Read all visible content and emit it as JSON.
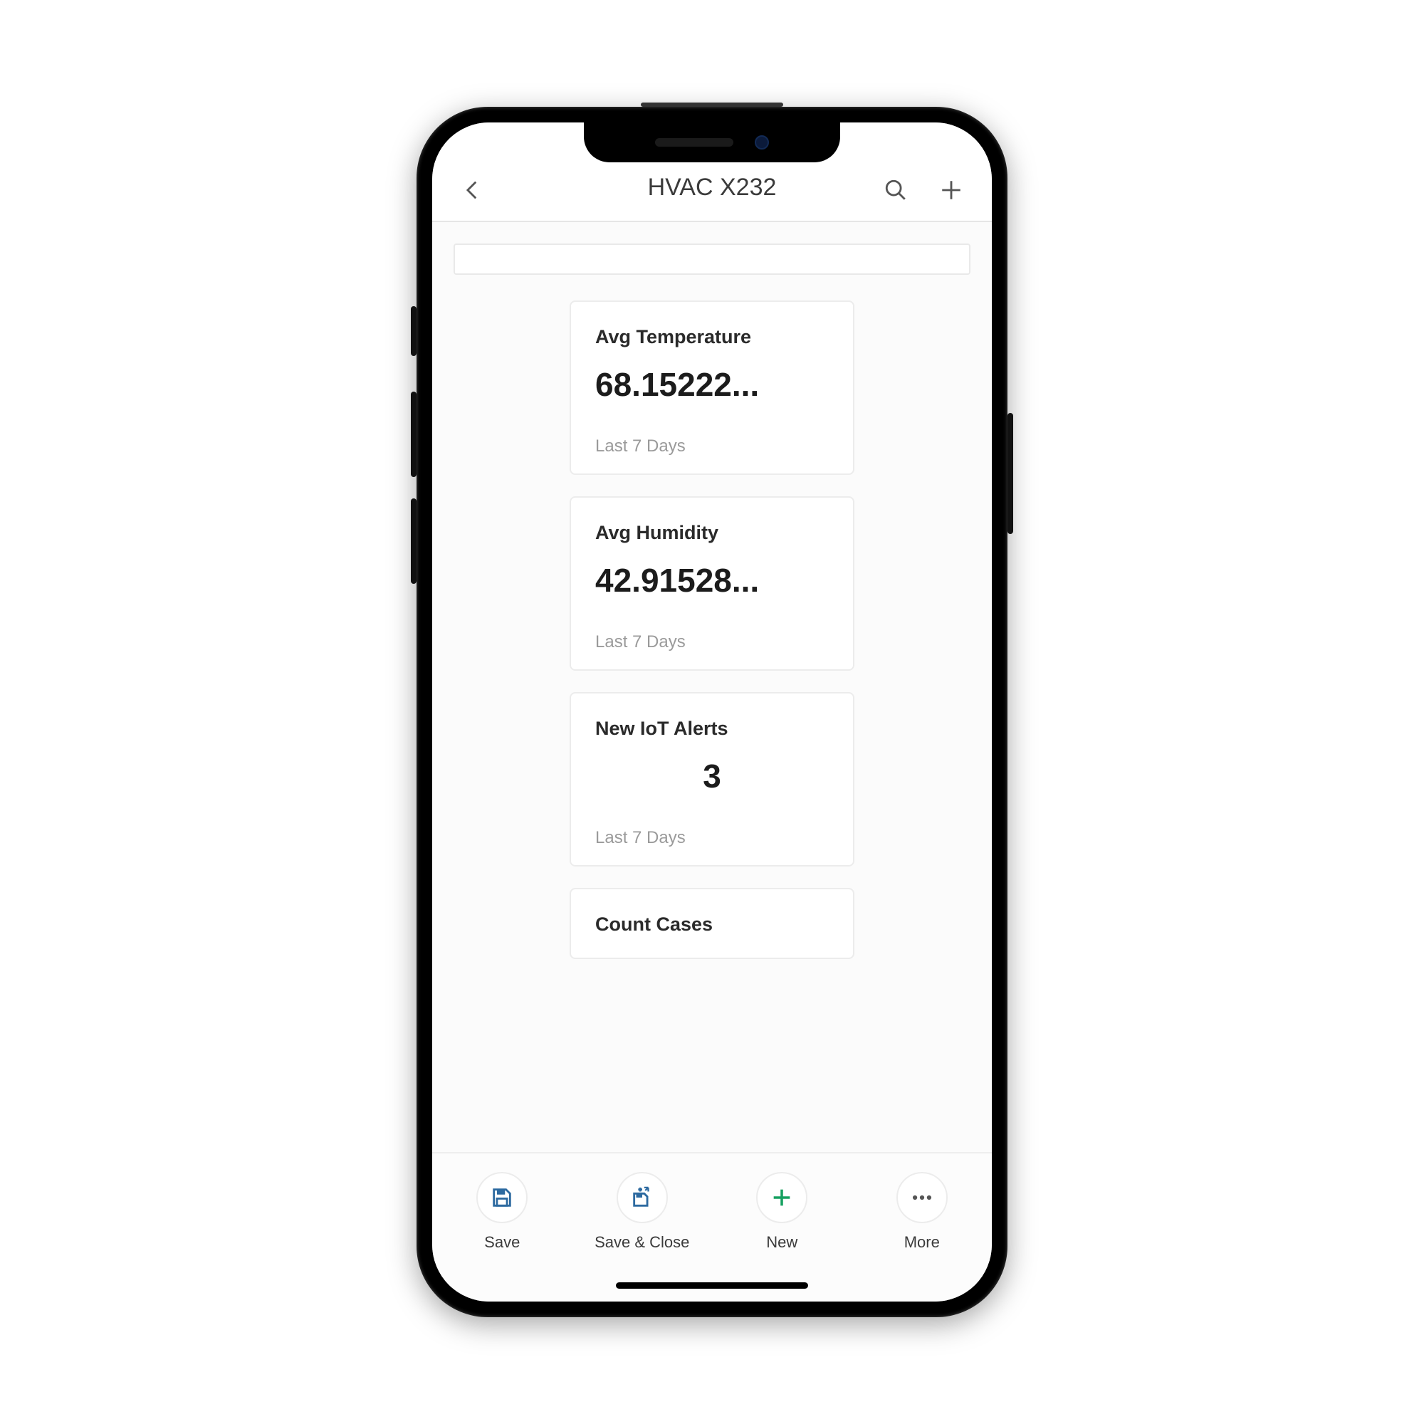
{
  "header": {
    "title": "HVAC X232"
  },
  "cards": [
    {
      "title": "Avg Temperature",
      "value": "68.15222...",
      "sub": "Last 7 Days",
      "centered": false
    },
    {
      "title": "Avg Humidity",
      "value": "42.91528...",
      "sub": "Last 7 Days",
      "centered": false
    },
    {
      "title": "New IoT Alerts",
      "value": "3",
      "sub": "Last 7 Days",
      "centered": true
    },
    {
      "title": "Count Cases",
      "value": "",
      "sub": "",
      "centered": false
    }
  ],
  "footer": {
    "save": "Save",
    "save_close": "Save & Close",
    "new": "New",
    "more": "More"
  }
}
